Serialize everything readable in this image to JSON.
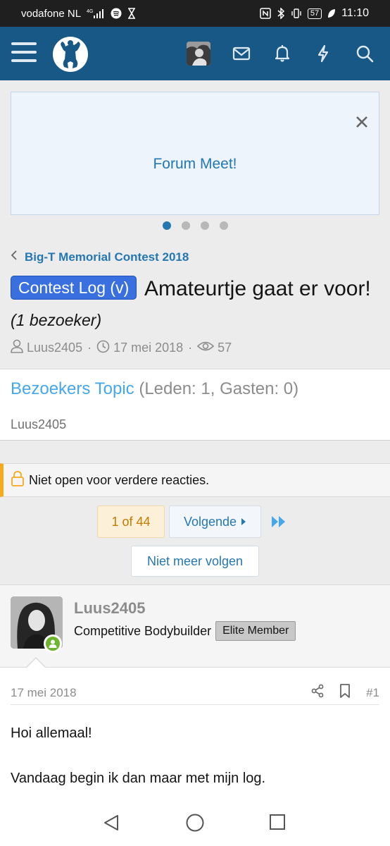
{
  "status_bar": {
    "carrier": "vodafone NL",
    "network": "4G",
    "battery": "57",
    "time": "11:10"
  },
  "header": {
    "menu_icon": "hamburger-icon",
    "logo_icon": "bodybuilder-logo",
    "icons": [
      "avatar",
      "envelope-icon",
      "bell-icon",
      "bolt-icon",
      "search-icon"
    ],
    "brand_color": "#185886"
  },
  "notice": {
    "text": "Forum Meet!",
    "slides": 4,
    "active_slide": 1
  },
  "breadcrumb": {
    "label": "Big-T Memorial Contest 2018"
  },
  "thread": {
    "prefix": "Contest Log (v)",
    "title": "Amateurtje gaat er voor!",
    "visitors_note": "(1 bezoeker)",
    "author": "Luus2405",
    "date": "17 mei 2018",
    "views": "57"
  },
  "visitors_topic": {
    "title": "Bezoekers Topic",
    "counts": "(Leden: 1, Gasten: 0)",
    "user": "Luus2405"
  },
  "locked_notice": {
    "text": "Niet open voor verdere reacties."
  },
  "pagination": {
    "current": "1 of 44",
    "next_label": "Volgende",
    "unfollow_label": "Niet meer volgen"
  },
  "post": {
    "username": "Luus2405",
    "user_title": "Competitive Bodybuilder",
    "badge": "Elite Member",
    "date": "17 mei 2018",
    "number": "#1",
    "body": [
      "Hoi allemaal!",
      "Vandaag begin ik dan maar met mijn log."
    ]
  }
}
